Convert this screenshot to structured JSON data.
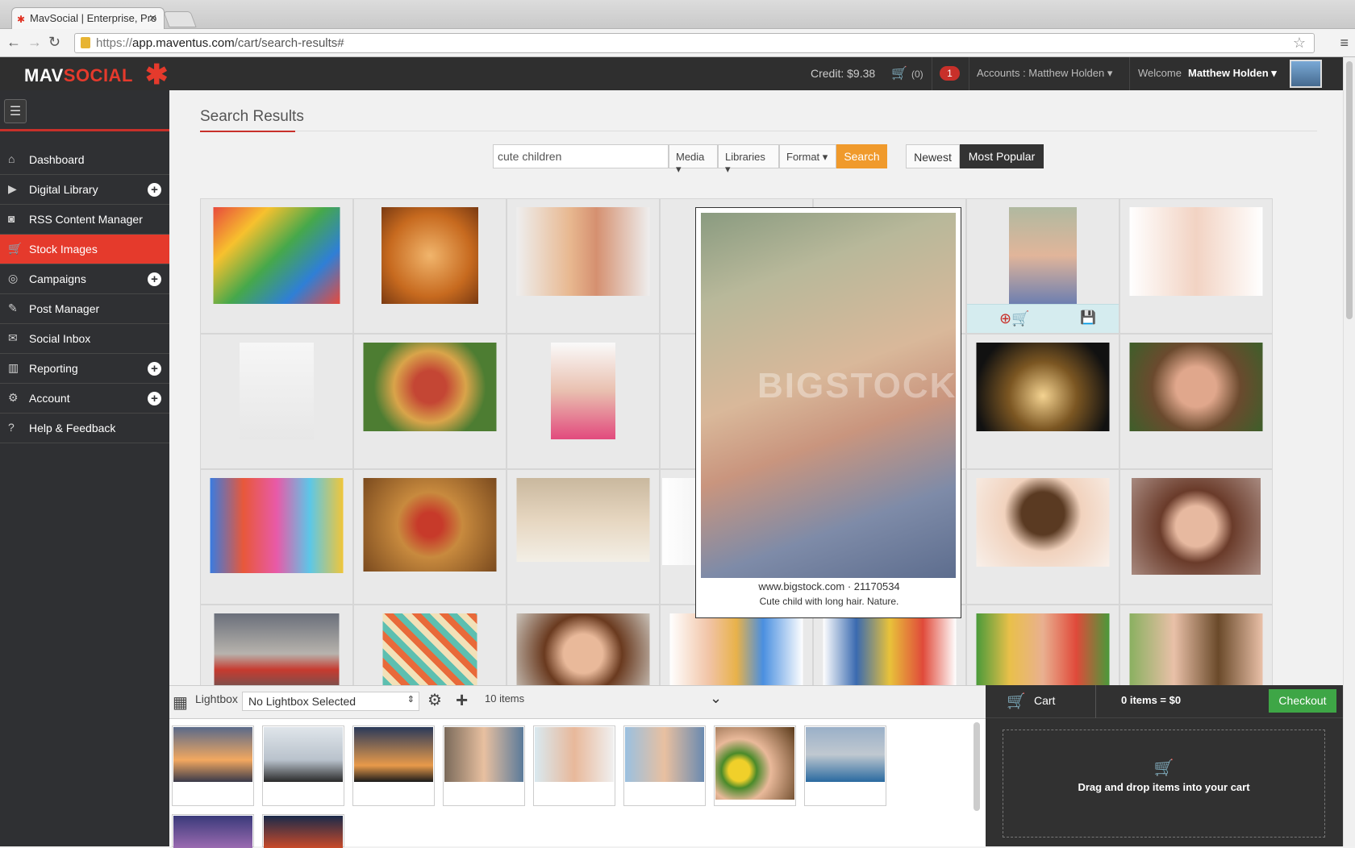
{
  "browser": {
    "tab_title": "MavSocial | Enterprise, Pro",
    "url_proto": "https://",
    "url_host": "app.maventus.com",
    "url_path": "/cart/search-results#"
  },
  "topbar": {
    "logo_a": "MAV",
    "logo_b": "SOCIAL",
    "credit": "Credit: $9.38",
    "cart_count": "(0)",
    "notifications": "1",
    "accounts": "Accounts : Matthew Holden",
    "welcome": "Welcome",
    "user_name": "Matthew Holden"
  },
  "sidebar": {
    "items": [
      {
        "label": "Dashboard",
        "icon": "home-icon",
        "has_plus": false
      },
      {
        "label": "Digital Library",
        "icon": "play-icon",
        "has_plus": true
      },
      {
        "label": "RSS Content Manager",
        "icon": "rss-icon",
        "has_plus": false
      },
      {
        "label": "Stock Images",
        "icon": "cart-icon",
        "has_plus": false,
        "active": true
      },
      {
        "label": "Campaigns",
        "icon": "target-icon",
        "has_plus": true
      },
      {
        "label": "Post Manager",
        "icon": "edit-icon",
        "has_plus": false
      },
      {
        "label": "Social Inbox",
        "icon": "envelope-icon",
        "has_plus": false
      },
      {
        "label": "Reporting",
        "icon": "chart-icon",
        "has_plus": true
      },
      {
        "label": "Account",
        "icon": "gear-icon",
        "has_plus": true
      },
      {
        "label": "Help & Feedback",
        "icon": "question-icon",
        "has_plus": false
      }
    ]
  },
  "main": {
    "title": "Search Results",
    "search_value": "cute children",
    "filters": {
      "media": "Media",
      "libraries": "Libraries",
      "format": "Format"
    },
    "search_btn": "Search",
    "sort_newest": "Newest",
    "sort_popular": "Most Popular"
  },
  "popup": {
    "source": "www.bigstock.com · 21170534",
    "caption": "Cute child with long hair. Nature.",
    "watermark": "BIGSTOCK"
  },
  "lightbox": {
    "label": "Lightbox",
    "select_value": "No Lightbox Selected",
    "count": "10 items"
  },
  "cart": {
    "label": "Cart",
    "total": "0 items = $0",
    "checkout": "Checkout",
    "drop_text": "Drag and drop items into your cart"
  },
  "colors": {
    "accent": "#e53a2c",
    "search": "#f09a2c",
    "checkout": "#3ea646",
    "sidebar": "#2f3033"
  }
}
